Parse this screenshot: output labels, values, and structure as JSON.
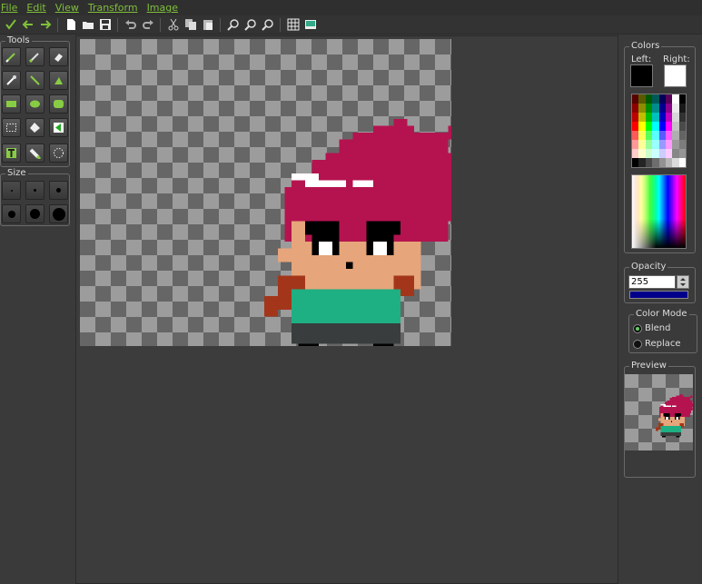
{
  "menu": [
    "File",
    "Edit",
    "View",
    "Transform",
    "Image"
  ],
  "toolbar": {
    "icons": [
      "checkmark-icon",
      "arrow-left-icon",
      "arrow-right-icon",
      "new-file-icon",
      "open-folder-icon",
      "save-icon",
      "undo-icon",
      "redo-icon",
      "cut-icon",
      "copy-icon",
      "paste-icon",
      "zoom-in-icon",
      "zoom-out-icon",
      "zoom-fit-icon",
      "grid-icon",
      "image-icon"
    ]
  },
  "tools": {
    "title": "Tools",
    "items": [
      "pencil-icon",
      "brush-icon",
      "eraser-icon",
      "color-picker-icon",
      "line-icon",
      "curve-icon",
      "rectangle-icon",
      "ellipse-icon",
      "rounded-rectangle-icon",
      "select-icon",
      "fill-icon",
      "replace-color-icon",
      "text-icon",
      "stamp-icon",
      "lasso-icon"
    ]
  },
  "size": {
    "title": "Size",
    "items": [
      1,
      2,
      3,
      4,
      5,
      6
    ]
  },
  "colors": {
    "title": "Colors",
    "left_label": "Left:",
    "right_label": "Right:",
    "left_color": "#000000",
    "right_color": "#ffffff"
  },
  "opacity": {
    "title": "Opacity",
    "value": "255"
  },
  "color_mode": {
    "title": "Color Mode",
    "options": [
      "Blend",
      "Replace"
    ],
    "selected": "Blend"
  },
  "preview": {
    "title": "Preview"
  },
  "sprite": {
    "hair": "#b5134f",
    "skin": "#e6a57a",
    "shirt": "#1eaf83",
    "pants": "#3a3d3d",
    "cape": "#a3361a",
    "band": "#ffffff",
    "eye": "#000000"
  }
}
